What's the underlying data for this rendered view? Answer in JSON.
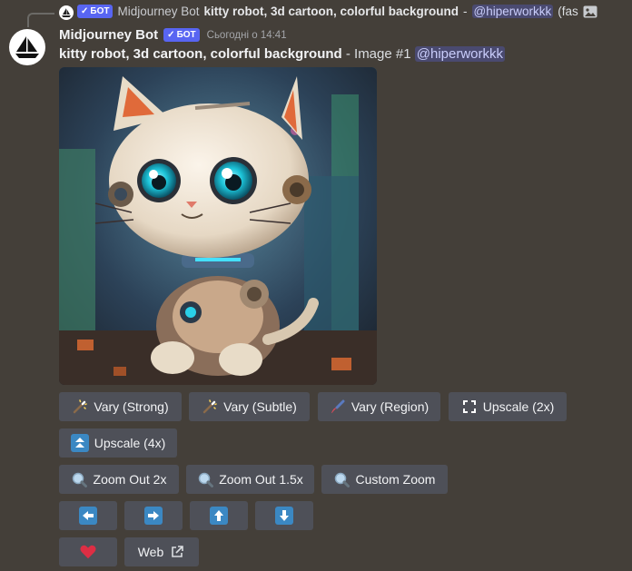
{
  "reply": {
    "bot_label": "БОТ",
    "username": "Midjourney Bot",
    "prompt": "kitty robot, 3d cartoon, colorful background",
    "separator": "-",
    "mention": "@hiperworkkk",
    "suffix": "(fas"
  },
  "message": {
    "username": "Midjourney Bot",
    "bot_label": "БОТ",
    "timestamp": "Сьогодні о 14:41",
    "prompt": "kitty robot, 3d cartoon, colorful background",
    "image_info": "- Image #1",
    "mention": "@hiperworkkk",
    "image_icon": "generated-image"
  },
  "buttons": {
    "vary_strong": "Vary (Strong)",
    "vary_subtle": "Vary (Subtle)",
    "vary_region": "Vary (Region)",
    "upscale_2x": "Upscale (2x)",
    "upscale_4x": "Upscale (4x)",
    "zoom_out_2x": "Zoom Out 2x",
    "zoom_out_1_5x": "Zoom Out 1.5x",
    "custom_zoom": "Custom Zoom",
    "web": "Web"
  },
  "icons": {
    "vary": "magic-wand-icon",
    "region": "paintbrush-icon",
    "upscale2": "expand-icon",
    "upscale4": "double-up-arrow-icon",
    "zoom": "magnifier-icon",
    "left": "arrow-left-icon",
    "right": "arrow-right-icon",
    "up": "arrow-up-icon",
    "down": "arrow-down-icon",
    "heart": "heart-icon",
    "external": "external-link-icon"
  },
  "colors": {
    "background": "#443f39",
    "button": "#4e5058",
    "bot_badge": "#5865f2",
    "arrow_box": "#3b88c3",
    "heart": "#dd2e44"
  }
}
